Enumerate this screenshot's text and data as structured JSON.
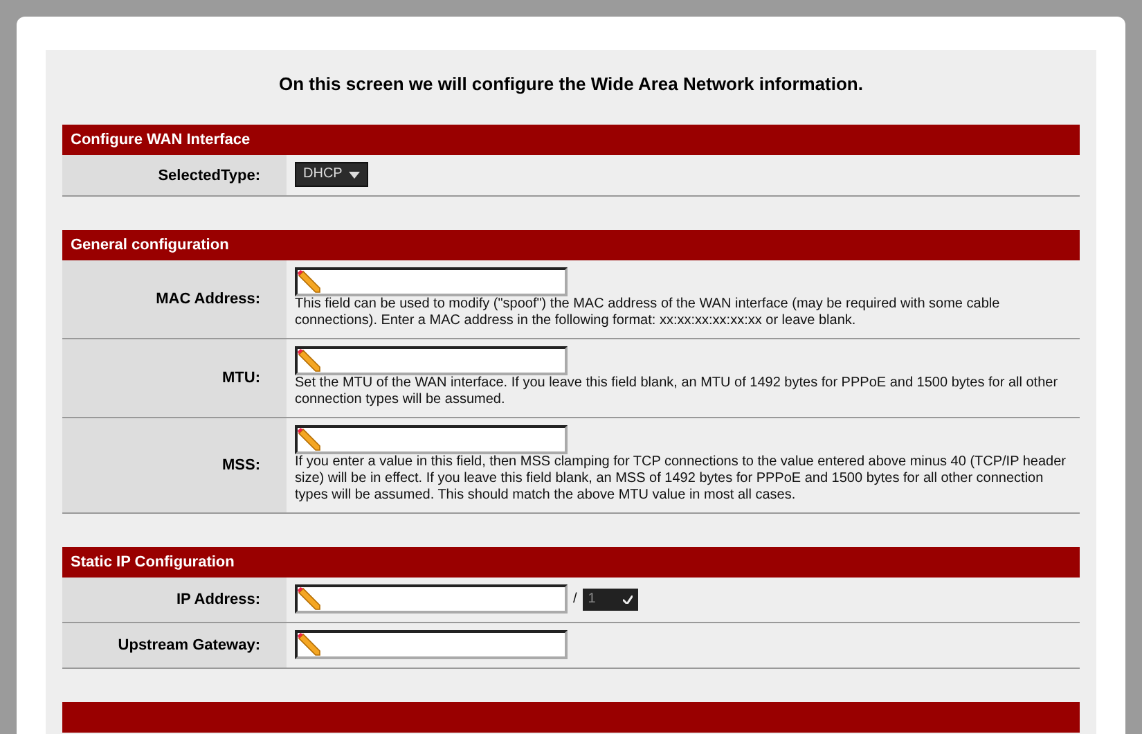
{
  "heading": "On this screen we will configure the Wide Area Network information.",
  "sections": [
    {
      "title": "Configure WAN Interface",
      "rows": [
        {
          "kind": "select",
          "label": "SelectedType:",
          "value": "DHCP"
        }
      ]
    },
    {
      "title": "General configuration",
      "rows": [
        {
          "kind": "text",
          "label": "MAC Address:",
          "description": "This field can be used to modify (\"spoof\") the MAC address of the WAN interface (may be required with some cable connections). Enter a MAC address in the following format: xx:xx:xx:xx:xx:xx or leave blank."
        },
        {
          "kind": "text",
          "label": "MTU:",
          "description": "Set the MTU of the WAN interface. If you leave this field blank, an MTU of 1492 bytes for PPPoE and 1500 bytes for all other connection types will be assumed."
        },
        {
          "kind": "text",
          "label": "MSS:",
          "description": "If you enter a value in this field, then MSS clamping for TCP connections to the value entered above minus 40 (TCP/IP header size) will be in effect. If you leave this field blank, an MSS of 1492 bytes for PPPoE and 1500 bytes for all other connection types will be assumed. This should match the above MTU value in most all cases."
        }
      ]
    },
    {
      "title": "Static IP Configuration",
      "rows": [
        {
          "kind": "ip",
          "label": "IP Address:",
          "separator": "/",
          "subnet": "1"
        },
        {
          "kind": "text",
          "label": "Upstream Gateway:"
        }
      ]
    }
  ]
}
